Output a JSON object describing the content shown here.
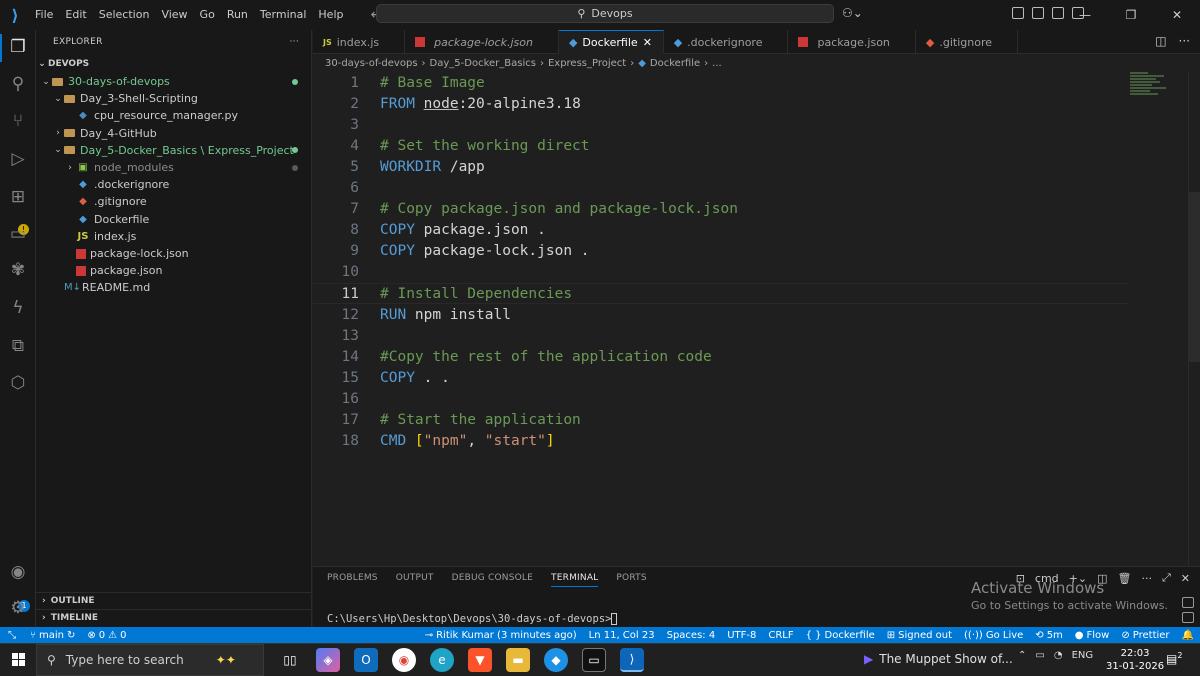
{
  "titlebar": {
    "menu": [
      "File",
      "Edit",
      "Selection",
      "View",
      "Go",
      "Run",
      "Terminal",
      "Help"
    ],
    "search": "Devops"
  },
  "explorer": {
    "header": "EXPLORER",
    "workspace": "DEVOPS",
    "tree": [
      {
        "label": "30-days-of-devops",
        "depth": 0,
        "type": "folder-open",
        "modified": true
      },
      {
        "label": "Day_3-Shell-Scripting",
        "depth": 1,
        "type": "folder-open"
      },
      {
        "label": "cpu_resource_manager.py",
        "depth": 2,
        "type": "py"
      },
      {
        "label": "Day_4-GitHub",
        "depth": 1,
        "type": "folder-closed"
      },
      {
        "label": "Day_5-Docker_Basics \\ Express_Project",
        "depth": 1,
        "type": "folder-open",
        "modified": true
      },
      {
        "label": "node_modules",
        "depth": 2,
        "type": "node-folder",
        "faded": true
      },
      {
        "label": ".dockerignore",
        "depth": 2,
        "type": "docker"
      },
      {
        "label": ".gitignore",
        "depth": 2,
        "type": "git"
      },
      {
        "label": "Dockerfile",
        "depth": 2,
        "type": "docker"
      },
      {
        "label": "index.js",
        "depth": 2,
        "type": "js"
      },
      {
        "label": "package-lock.json",
        "depth": 2,
        "type": "npm"
      },
      {
        "label": "package.json",
        "depth": 2,
        "type": "npm"
      },
      {
        "label": "README.md",
        "depth": 1,
        "type": "md"
      }
    ],
    "outline": "OUTLINE",
    "timeline": "TIMELINE"
  },
  "tabs": [
    {
      "label": "index.js",
      "icon": "js",
      "italic": false,
      "active": false
    },
    {
      "label": "package-lock.json",
      "icon": "npm",
      "italic": true,
      "active": false
    },
    {
      "label": "Dockerfile",
      "icon": "docker",
      "italic": false,
      "active": true
    },
    {
      "label": ".dockerignore",
      "icon": "docker",
      "italic": false,
      "active": false
    },
    {
      "label": "package.json",
      "icon": "npm",
      "italic": false,
      "active": false
    },
    {
      "label": ".gitignore",
      "icon": "git",
      "italic": false,
      "active": false
    }
  ],
  "breadcrumb": [
    "30-days-of-devops",
    "Day_5-Docker_Basics",
    "Express_Project",
    "Dockerfile",
    "..."
  ],
  "editor": {
    "current_line": 11,
    "lines": [
      [
        {
          "t": "# Base Image",
          "c": "cm"
        }
      ],
      [
        {
          "t": "FROM ",
          "c": "kw"
        },
        {
          "t": "node",
          "c": "tx ul"
        },
        {
          "t": ":20-alpine3.18",
          "c": "tx"
        }
      ],
      [],
      [
        {
          "t": "# Set the working direct",
          "c": "cm"
        }
      ],
      [
        {
          "t": "WORKDIR ",
          "c": "kw"
        },
        {
          "t": "/app",
          "c": "tx"
        }
      ],
      [],
      [
        {
          "t": "# Copy package.json and package-lock.json",
          "c": "cm"
        }
      ],
      [
        {
          "t": "COPY ",
          "c": "kw"
        },
        {
          "t": "package.json .",
          "c": "tx"
        }
      ],
      [
        {
          "t": "COPY ",
          "c": "kw"
        },
        {
          "t": "package-lock.json .",
          "c": "tx"
        }
      ],
      [],
      [
        {
          "t": "# Install Dependencies",
          "c": "cm"
        }
      ],
      [
        {
          "t": "RUN ",
          "c": "kw"
        },
        {
          "t": "npm install",
          "c": "tx"
        }
      ],
      [],
      [
        {
          "t": "#Copy the rest of the application code",
          "c": "cm"
        }
      ],
      [
        {
          "t": "COPY ",
          "c": "kw"
        },
        {
          "t": ". .",
          "c": "tx"
        }
      ],
      [],
      [
        {
          "t": "# Start the application",
          "c": "cm"
        }
      ],
      [
        {
          "t": "CMD ",
          "c": "kw"
        },
        {
          "t": "[",
          "c": "br"
        },
        {
          "t": "\"npm\"",
          "c": "st"
        },
        {
          "t": ", ",
          "c": "tx"
        },
        {
          "t": "\"start\"",
          "c": "st"
        },
        {
          "t": "]",
          "c": "br"
        }
      ]
    ]
  },
  "panel": {
    "tabs": [
      "PROBLEMS",
      "OUTPUT",
      "DEBUG CONSOLE",
      "TERMINAL",
      "PORTS"
    ],
    "active_tab": "TERMINAL",
    "terminal_label": "cmd",
    "prompt": "C:\\Users\\Hp\\Desktop\\Devops\\30-days-of-devops>",
    "activate_title": "Activate Windows",
    "activate_sub": "Go to Settings to activate Windows."
  },
  "statusbar": {
    "branch": "main",
    "errors": "0",
    "warnings": "0",
    "blame": "Ritik Kumar (3 minutes ago)",
    "position": "Ln 11, Col 23",
    "spaces": "Spaces: 4",
    "encoding": "UTF-8",
    "eol": "CRLF",
    "language": "Dockerfile",
    "signed": "Signed out",
    "golive": "Go Live",
    "timer": "5m",
    "flow": "Flow",
    "prettier": "Prettier"
  },
  "taskbar": {
    "search_placeholder": "Type here to search",
    "media_title": "The Muppet Show of...",
    "lang": "ENG",
    "time": "22:03",
    "date": "31-01-2026",
    "notif_count": "2"
  },
  "colors": {
    "accent": "#0078d4",
    "comment": "#6a9955",
    "keyword": "#569cd6",
    "string": "#ce9178",
    "git_modified": "#73c991"
  }
}
